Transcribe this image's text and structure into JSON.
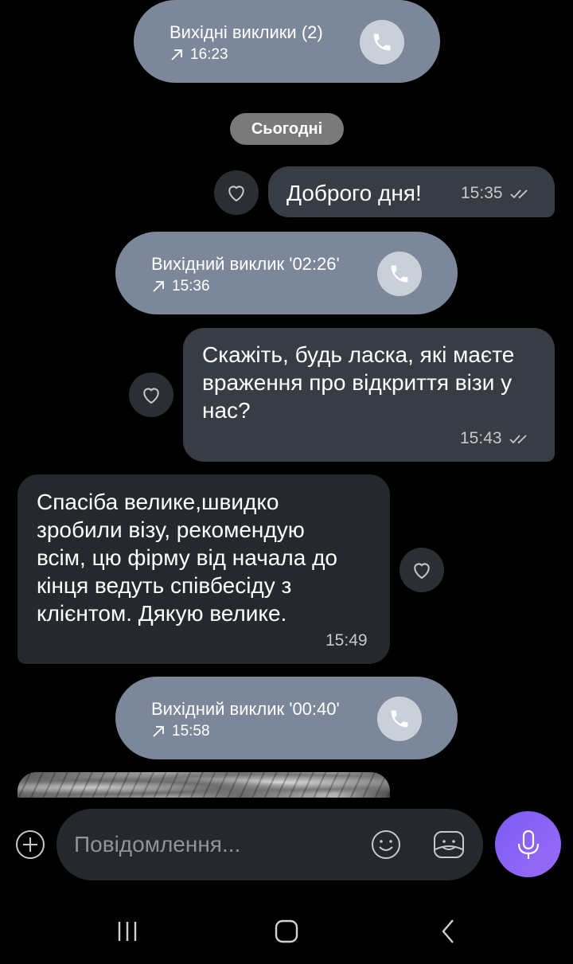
{
  "calls": [
    {
      "title": "Вихідні виклики (2)",
      "time": "16:23"
    },
    {
      "title": "Вихідний виклик '02:26'",
      "time": "15:36"
    },
    {
      "title": "Вихідний виклик '00:40'",
      "time": "15:58"
    }
  ],
  "date_separator": "Сьогодні",
  "messages": [
    {
      "direction": "outgoing",
      "text": "Доброго дня!",
      "time": "15:35",
      "status": "read"
    },
    {
      "direction": "outgoing",
      "text": "Скажіть, будь ласка, які маєте враження про відкриття візи у нас?",
      "time": "15:43",
      "status": "read"
    },
    {
      "direction": "incoming",
      "text": "Спасіба велике,швидко зробили візу, рекомендую всім, цю фірму від начала до кінця ведуть співбесіду з клієнтом. Дякую велике.",
      "time": "15:49"
    }
  ],
  "composer": {
    "placeholder": "Повідомлення..."
  },
  "colors": {
    "background": "#000000",
    "call_pill": "#7c8899",
    "outgoing_bubble": "#383c44",
    "incoming_bubble": "#25282d",
    "mic_button": "#7b5cf5"
  },
  "icons": {
    "call": "phone-icon",
    "outgoing_arrow": "arrow-up-right-icon",
    "reaction": "heart-icon",
    "read_status": "double-check-icon",
    "attach": "plus-circle-icon",
    "emoji": "smiley-icon",
    "sticker": "sticker-icon",
    "voice": "microphone-icon",
    "nav_recents": "recents-icon",
    "nav_home": "home-icon",
    "nav_back": "back-icon"
  }
}
